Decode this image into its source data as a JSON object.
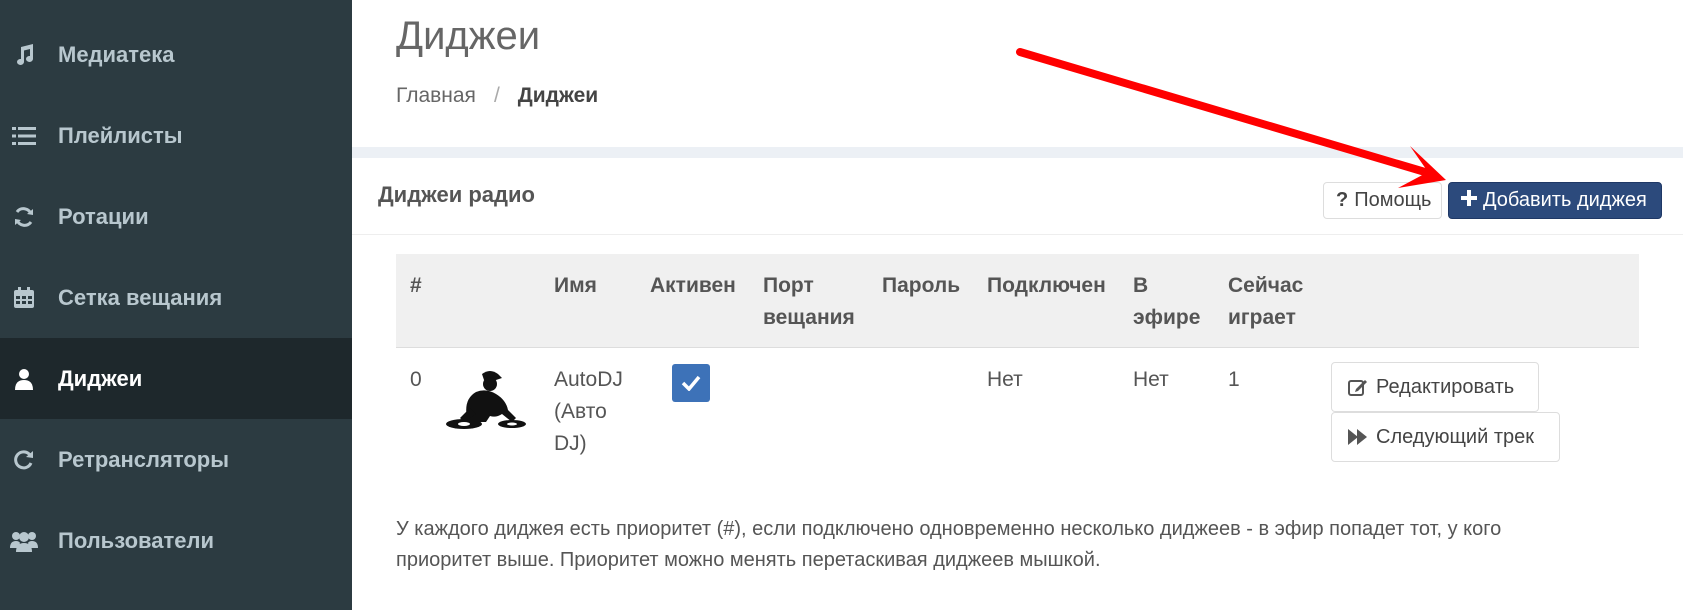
{
  "sidebar": {
    "items": [
      {
        "label": "Медиатека",
        "icon": "music-icon"
      },
      {
        "label": "Плейлисты",
        "icon": "list-icon"
      },
      {
        "label": "Ротации",
        "icon": "refresh-icon"
      },
      {
        "label": "Сетка вещания",
        "icon": "calendar-icon"
      },
      {
        "label": "Диджеи",
        "icon": "user-icon",
        "active": true
      },
      {
        "label": "Ретрансляторы",
        "icon": "repeat-icon"
      },
      {
        "label": "Пользователи",
        "icon": "users-icon"
      }
    ]
  },
  "header": {
    "title": "Диджеи",
    "breadcrumb": {
      "home": "Главная",
      "separator": "/",
      "current": "Диджеи"
    }
  },
  "box": {
    "title": "Диджеи радио",
    "help_label": "Помощь",
    "add_label": "Добавить диджея"
  },
  "table": {
    "columns": [
      {
        "line1": "#",
        "line2": ""
      },
      {
        "line1": "Имя",
        "line2": ""
      },
      {
        "line1": "Активен",
        "line2": ""
      },
      {
        "line1": "Порт",
        "line2": "вещания"
      },
      {
        "line1": "Пароль",
        "line2": ""
      },
      {
        "line1": "Подключен",
        "line2": ""
      },
      {
        "line1": "В",
        "line2": "эфире"
      },
      {
        "line1": "Сейчас",
        "line2": "играет"
      }
    ],
    "rows": [
      {
        "priority": "0",
        "name_lines": [
          "AutoDJ",
          "(Авто",
          "DJ)"
        ],
        "active": true,
        "port": "",
        "password": "",
        "connected": "Нет",
        "on_air": "Нет",
        "now_playing": "1",
        "edit_label": "Редактировать",
        "next_label": "Следующий трек"
      }
    ]
  },
  "note": "У каждого диджея есть приоритет (#), если подключено одновременно несколько диджеев - в эфир попадет тот, у кого приоритет выше. Приоритет можно менять перетаскивая диджеев мышкой.",
  "colors": {
    "sidebar_bg": "#2c3b41",
    "sidebar_active_bg": "#1e282c",
    "primary_button": "#2c4a7c",
    "checkbox": "#3d72b8",
    "annotation_arrow": "#ff0000"
  }
}
